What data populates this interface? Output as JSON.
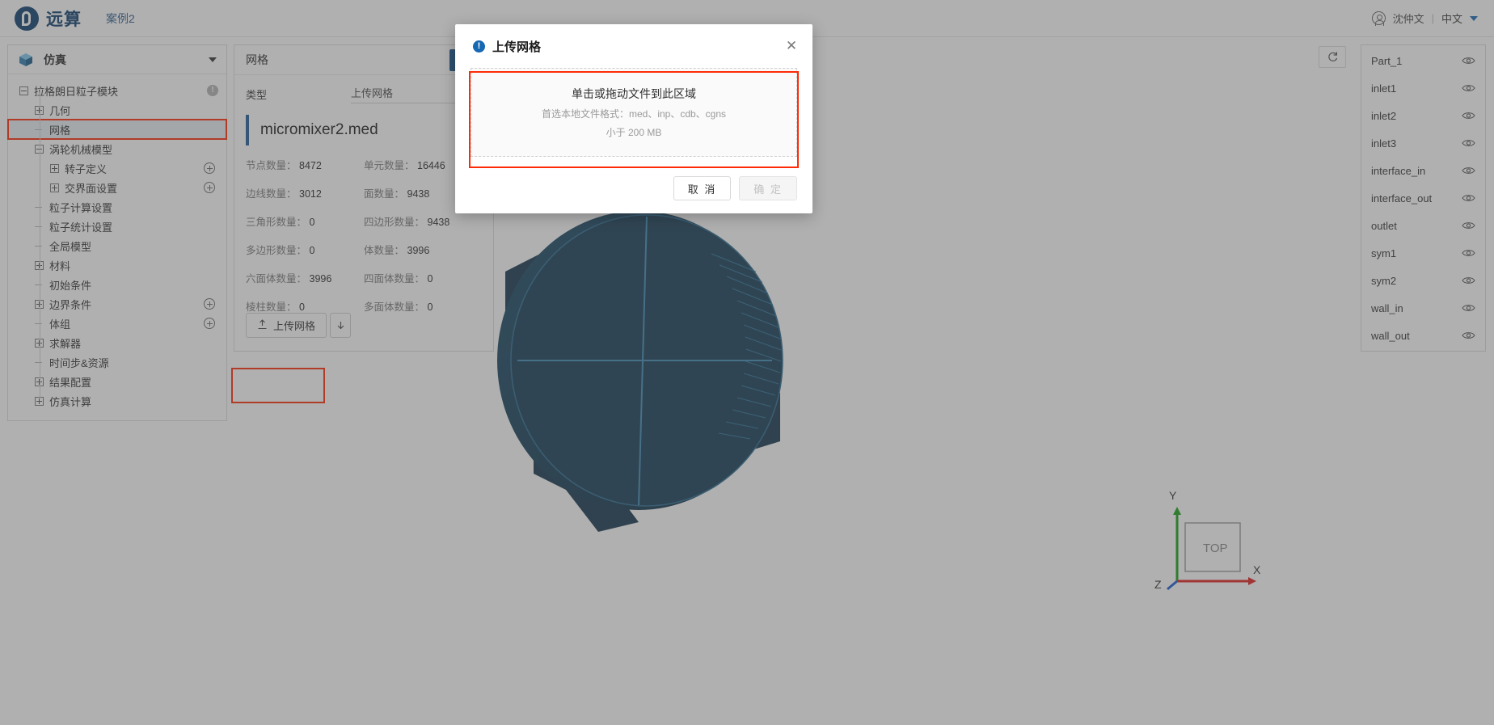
{
  "topbar": {
    "brand": "远算",
    "case_name": "案例2",
    "user_name": "沈仲文",
    "separator": "|",
    "language": "中文"
  },
  "sidebar": {
    "title": "仿真",
    "tree": [
      {
        "label": "拉格朗日粒子模块",
        "toggle": "minus",
        "depth": 0,
        "badge": "!"
      },
      {
        "label": "几何",
        "toggle": "plus",
        "depth": 1
      },
      {
        "label": "网格",
        "toggle": "stub",
        "depth": 1,
        "selected": true
      },
      {
        "label": "涡轮机械模型",
        "toggle": "minus",
        "depth": 1
      },
      {
        "label": "转子定义",
        "toggle": "plus",
        "depth": 2,
        "plus_action": true
      },
      {
        "label": "交界面设置",
        "toggle": "plus",
        "depth": 2,
        "plus_action": true
      },
      {
        "label": "粒子计算设置",
        "toggle": "stub",
        "depth": 1
      },
      {
        "label": "粒子统计设置",
        "toggle": "stub",
        "depth": 1
      },
      {
        "label": "全局模型",
        "toggle": "stub",
        "depth": 1
      },
      {
        "label": "材料",
        "toggle": "plus",
        "depth": 1
      },
      {
        "label": "初始条件",
        "toggle": "stub",
        "depth": 1
      },
      {
        "label": "边界条件",
        "toggle": "plus",
        "depth": 1,
        "plus_action": true
      },
      {
        "label": "体组",
        "toggle": "stub",
        "depth": 1,
        "plus_action": true
      },
      {
        "label": "求解器",
        "toggle": "plus",
        "depth": 1
      },
      {
        "label": "时间步&资源",
        "toggle": "stub",
        "depth": 1
      },
      {
        "label": "结果配置",
        "toggle": "plus",
        "depth": 1
      },
      {
        "label": "仿真计算",
        "toggle": "plus",
        "depth": 1
      }
    ]
  },
  "properties": {
    "header_title": "网格",
    "confirm_icon": "✓",
    "type_label": "类型",
    "type_value": "上传网格",
    "file_name": "micromixer2.med",
    "stats": [
      {
        "key": "节点数量：",
        "value": "8472"
      },
      {
        "key": "单元数量：",
        "value": "16446"
      },
      {
        "key": "边线数量：",
        "value": "3012"
      },
      {
        "key": "面数量：",
        "value": "9438"
      },
      {
        "key": "三角形数量：",
        "value": "0"
      },
      {
        "key": "四边形数量：",
        "value": "9438"
      },
      {
        "key": "多边形数量：",
        "value": "0"
      },
      {
        "key": "体数量：",
        "value": "3996"
      },
      {
        "key": "六面体数量：",
        "value": "3996"
      },
      {
        "key": "四面体数量：",
        "value": "0"
      },
      {
        "key": "棱柱数量：",
        "value": "0"
      },
      {
        "key": "多面体数量：",
        "value": "0"
      }
    ],
    "upload_button": "上传网格",
    "upload_icon": "upload-icon",
    "dropdown_icon": "arrow-down-icon"
  },
  "parts_panel": {
    "refresh_icon": "refresh-icon",
    "items": [
      {
        "label": "Part_1",
        "visible_icon": "eye-icon"
      },
      {
        "label": "inlet1",
        "visible_icon": "eye-icon"
      },
      {
        "label": "inlet2",
        "visible_icon": "eye-icon"
      },
      {
        "label": "inlet3",
        "visible_icon": "eye-icon"
      },
      {
        "label": "interface_in",
        "visible_icon": "eye-icon"
      },
      {
        "label": "interface_out",
        "visible_icon": "eye-icon"
      },
      {
        "label": "outlet",
        "visible_icon": "eye-icon"
      },
      {
        "label": "sym1",
        "visible_icon": "eye-icon"
      },
      {
        "label": "sym2",
        "visible_icon": "eye-icon"
      },
      {
        "label": "wall_in",
        "visible_icon": "eye-icon"
      },
      {
        "label": "wall_out",
        "visible_icon": "eye-icon"
      }
    ]
  },
  "viewport": {
    "axis_x": "X",
    "axis_y": "Y",
    "axis_z": "Z",
    "cube_label": "TOP",
    "model_color": "#153a52"
  },
  "modal": {
    "title": "上传网格",
    "info_icon": "info-icon",
    "close_icon": "✕",
    "dropzone_main": "单击或拖动文件到此区域",
    "dropzone_sub1": "首选本地文件格式：med、inp、cdb、cgns",
    "dropzone_sub2": "小于 200 MB",
    "cancel_label": "取 消",
    "ok_label": "确 定"
  },
  "highlight_color": "#ff2b06"
}
